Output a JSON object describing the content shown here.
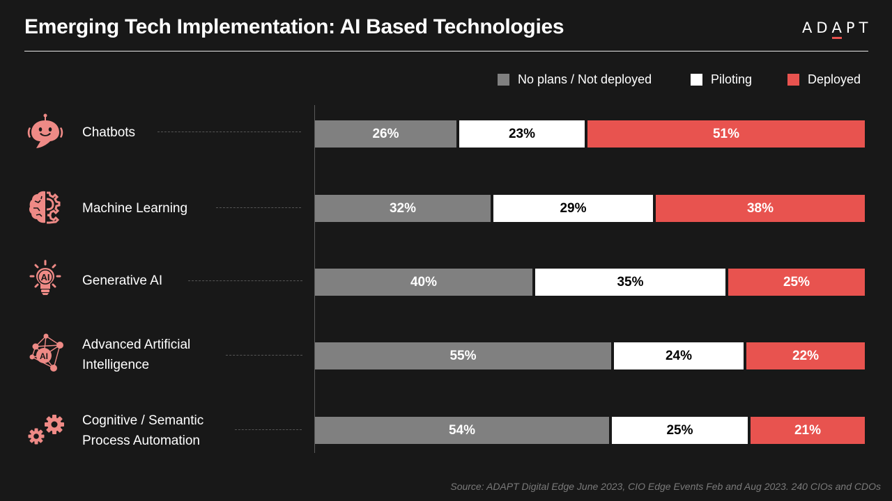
{
  "header": {
    "title": "Emerging Tech Implementation: AI Based Technologies",
    "logo": {
      "before": "AD",
      "accent_letter": "A",
      "after": "PT"
    }
  },
  "colors": {
    "background": "#181818",
    "no_plans": "#808080",
    "piloting": "#ffffff",
    "deployed": "#e8534f",
    "icon": "#ee8a86"
  },
  "chart_data": {
    "type": "bar",
    "orientation": "horizontal",
    "stacked": true,
    "normalized": "100%",
    "title": "Emerging Tech Implementation: AI Based Technologies",
    "xlabel": "",
    "ylabel": "",
    "xlim": [
      0,
      100
    ],
    "grid": false,
    "legend_position": "top-right",
    "categories": [
      "Chatbots",
      "Machine Learning",
      "Generative AI",
      "Advanced Artificial Intelligence",
      "Cognitive / Semantic Process Automation"
    ],
    "series": [
      {
        "name": "No plans / Not deployed",
        "color": "#808080",
        "label_color": "#ffffff",
        "values": [
          26,
          32,
          40,
          55,
          54
        ]
      },
      {
        "name": "Piloting",
        "color": "#ffffff",
        "label_color": "#000000",
        "values": [
          23,
          29,
          35,
          24,
          25
        ]
      },
      {
        "name": "Deployed",
        "color": "#e8534f",
        "label_color": "#ffffff",
        "values": [
          51,
          38,
          25,
          22,
          21
        ]
      }
    ],
    "value_suffix": "%"
  },
  "rows": [
    {
      "label_lines": [
        "Chatbots"
      ],
      "icon": "chatbot-robot-icon"
    },
    {
      "label_lines": [
        "Machine Learning"
      ],
      "icon": "brain-gear-icon"
    },
    {
      "label_lines": [
        "Generative AI"
      ],
      "icon": "ai-lightbulb-icon"
    },
    {
      "label_lines": [
        "Advanced Artificial",
        "Intelligence"
      ],
      "icon": "ai-network-icon"
    },
    {
      "label_lines": [
        "Cognitive / Semantic",
        "Process Automation"
      ],
      "icon": "gears-icon"
    }
  ],
  "footer": {
    "source": "Source: ADAPT Digital Edge June 2023, CIO Edge Events Feb and Aug 2023. 240 CIOs and CDOs"
  }
}
